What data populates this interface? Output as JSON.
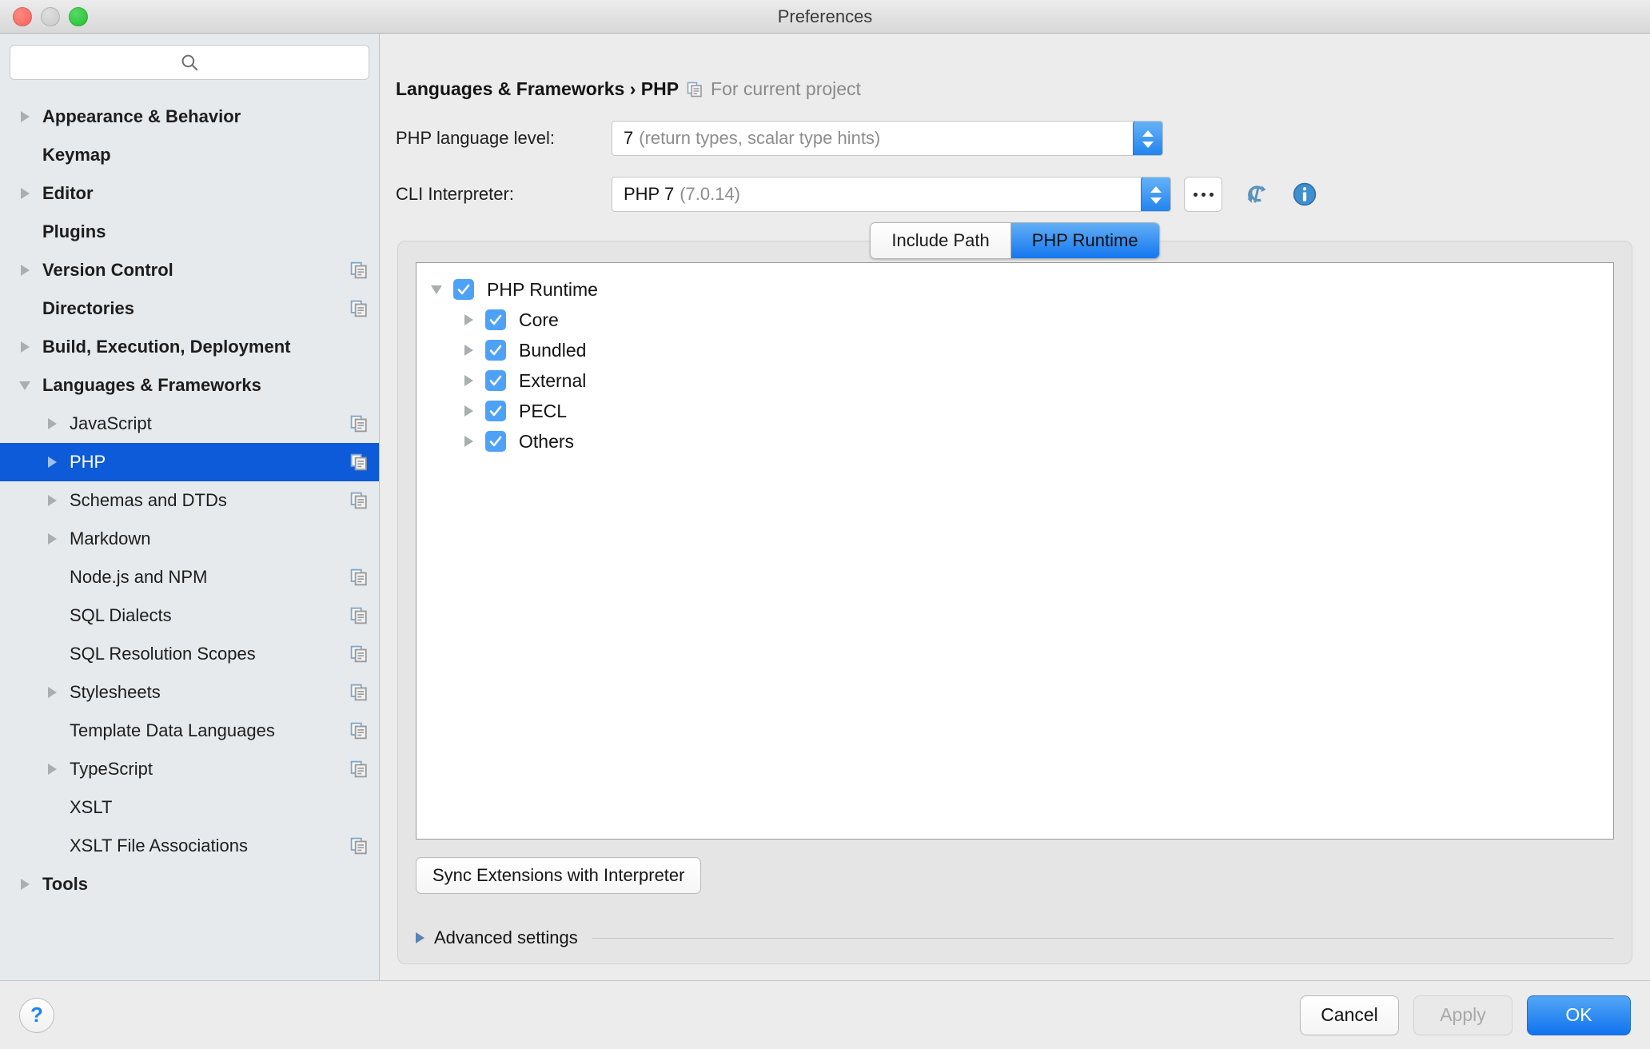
{
  "window": {
    "title": "Preferences",
    "traffic_lights": [
      "close",
      "minimize",
      "maximize"
    ]
  },
  "sidebar": {
    "search": {
      "value": "",
      "placeholder": ""
    },
    "items": [
      {
        "label": "Appearance & Behavior",
        "level": 0,
        "twisty": "right",
        "copy": false,
        "selected": false
      },
      {
        "label": "Keymap",
        "level": 0,
        "twisty": "none",
        "copy": false,
        "selected": false
      },
      {
        "label": "Editor",
        "level": 0,
        "twisty": "right",
        "copy": false,
        "selected": false
      },
      {
        "label": "Plugins",
        "level": 0,
        "twisty": "none",
        "copy": false,
        "selected": false
      },
      {
        "label": "Version Control",
        "level": 0,
        "twisty": "right",
        "copy": true,
        "selected": false
      },
      {
        "label": "Directories",
        "level": 0,
        "twisty": "none",
        "copy": true,
        "selected": false
      },
      {
        "label": "Build, Execution, Deployment",
        "level": 0,
        "twisty": "right",
        "copy": false,
        "selected": false
      },
      {
        "label": "Languages & Frameworks",
        "level": 0,
        "twisty": "down",
        "copy": false,
        "selected": false
      },
      {
        "label": "JavaScript",
        "level": 1,
        "twisty": "right",
        "copy": true,
        "selected": false
      },
      {
        "label": "PHP",
        "level": 1,
        "twisty": "right",
        "copy": true,
        "selected": true
      },
      {
        "label": "Schemas and DTDs",
        "level": 1,
        "twisty": "right",
        "copy": true,
        "selected": false
      },
      {
        "label": "Markdown",
        "level": 1,
        "twisty": "right",
        "copy": false,
        "selected": false
      },
      {
        "label": "Node.js and NPM",
        "level": 1,
        "twisty": "none",
        "copy": true,
        "selected": false
      },
      {
        "label": "SQL Dialects",
        "level": 1,
        "twisty": "none",
        "copy": true,
        "selected": false
      },
      {
        "label": "SQL Resolution Scopes",
        "level": 1,
        "twisty": "none",
        "copy": true,
        "selected": false
      },
      {
        "label": "Stylesheets",
        "level": 1,
        "twisty": "right",
        "copy": true,
        "selected": false
      },
      {
        "label": "Template Data Languages",
        "level": 1,
        "twisty": "none",
        "copy": true,
        "selected": false
      },
      {
        "label": "TypeScript",
        "level": 1,
        "twisty": "right",
        "copy": true,
        "selected": false
      },
      {
        "label": "XSLT",
        "level": 1,
        "twisty": "none",
        "copy": false,
        "selected": false
      },
      {
        "label": "XSLT File Associations",
        "level": 1,
        "twisty": "none",
        "copy": true,
        "selected": false
      },
      {
        "label": "Tools",
        "level": 0,
        "twisty": "right",
        "copy": false,
        "selected": false
      }
    ]
  },
  "content": {
    "breadcrumb": {
      "path": "Languages & Frameworks › PHP",
      "note": "For current project",
      "note_icon": "copy-icon"
    },
    "language_level": {
      "label": "PHP language level:",
      "value_strong": "7",
      "value_dim": "(return types, scalar type hints)"
    },
    "cli_interpreter": {
      "label": "CLI Interpreter:",
      "value_strong": "PHP 7",
      "value_dim": "(7.0.14)",
      "browse_label": "...",
      "refresh_icon": "refresh-icon",
      "info_icon": "info-icon"
    },
    "tabs": [
      {
        "label": "Include Path",
        "active": false
      },
      {
        "label": "PHP Runtime",
        "active": true
      }
    ],
    "tree": [
      {
        "label": "PHP Runtime",
        "depth": 0,
        "twisty": "down",
        "checked": true
      },
      {
        "label": "Core",
        "depth": 1,
        "twisty": "right",
        "checked": true
      },
      {
        "label": "Bundled",
        "depth": 1,
        "twisty": "right",
        "checked": true
      },
      {
        "label": "External",
        "depth": 1,
        "twisty": "right",
        "checked": true
      },
      {
        "label": "PECL",
        "depth": 1,
        "twisty": "right",
        "checked": true
      },
      {
        "label": "Others",
        "depth": 1,
        "twisty": "right",
        "checked": true
      }
    ],
    "sync_button": "Sync Extensions with Interpreter",
    "advanced_settings": "Advanced settings"
  },
  "footer": {
    "help_label": "?",
    "buttons": [
      {
        "label": "Cancel",
        "state": "normal"
      },
      {
        "label": "Apply",
        "state": "disabled"
      },
      {
        "label": "OK",
        "state": "primary"
      }
    ]
  },
  "colors": {
    "selection_blue": "#0d5bd8",
    "accent_blue": "#1477ef",
    "checkbox_blue": "#4da2f7",
    "sidebar_bg": "#e6eaed",
    "panel_bg": "#ececec"
  }
}
